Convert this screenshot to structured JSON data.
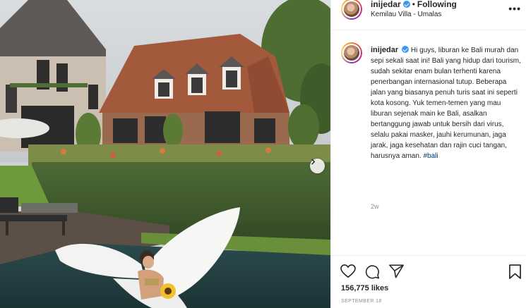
{
  "post": {
    "username": "inijedar",
    "follow_status": "Following",
    "location": "Kemilau Villa - Umalas",
    "caption_text": "Hi guys, liburan ke Bali murah dan sepi sekali saat ini! Bali yang hidup dari tourism, sudah sekitar enam bulan terhenti karena penerbangan internasional tutup. Beberapa jalan yang biasanya penuh turis saat ini seperti kota kosong. Yuk temen-temen yang mau liburan sejenak main ke Bali, asalkan bertanggung jawab untuk bersih dari virus, selalu pakai masker, jauhi kerumunan, jaga jarak, jaga kesehatan dan rajin cuci tangan, harusnya aman.",
    "hashtag": "#bali",
    "time_ago": "2w",
    "likes": "156,775 likes",
    "date": "SEPTEMBER 18"
  },
  "icons": {
    "more": "more-options-icon",
    "verified": "verified-badge-icon",
    "next": "chevron-right-icon",
    "like": "heart-icon",
    "comment": "comment-icon",
    "share": "paper-plane-icon",
    "save": "bookmark-icon"
  },
  "colors": {
    "verified": "#3897f0",
    "hashtag": "#00376b",
    "muted": "#8e8e8e",
    "border": "#efefef"
  }
}
